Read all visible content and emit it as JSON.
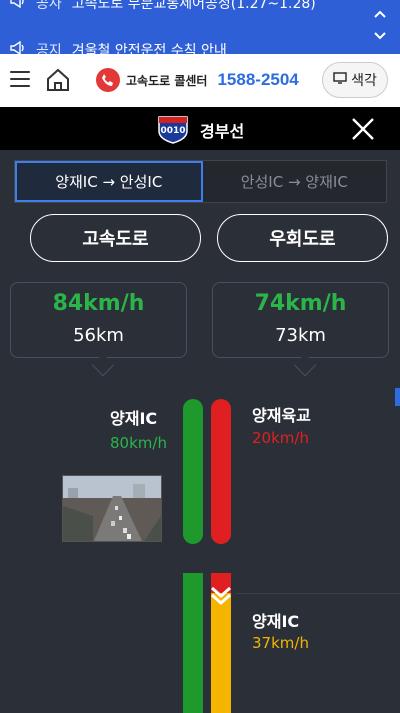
{
  "notice": {
    "items": [
      {
        "tag": "공사",
        "text": "고속도로 부분교통제어공정(1.27~1.28)"
      },
      {
        "tag": "공지",
        "text": "겨울철 안전운전 수칙 안내"
      }
    ]
  },
  "header": {
    "callcenter_label": "고속도로 콜센터",
    "callcenter_number": "1588-2504",
    "color_button_label": "색각"
  },
  "titlebar": {
    "route_number": "0010",
    "route_name": "경부선"
  },
  "direction_tabs": [
    {
      "label": "양재IC → 안성IC",
      "active": true
    },
    {
      "label": "안성IC → 양재IC",
      "active": false
    }
  ],
  "road_buttons": {
    "highway": "고속도로",
    "detour": "우회도로"
  },
  "speed_cards": [
    {
      "speed": "84km/h",
      "distance": "56km"
    },
    {
      "speed": "74km/h",
      "distance": "73km"
    }
  ],
  "segments": {
    "left_ic": {
      "name": "양재IC",
      "speed": "80km/h"
    },
    "right_top": {
      "name": "양재육교",
      "speed": "20km/h"
    },
    "right_bottom": {
      "name": "양재IC",
      "speed": "37km/h"
    }
  },
  "colors": {
    "green": "#1e9a2d",
    "red": "#e02020",
    "yellow": "#f5b400",
    "accent": "#2e6de0"
  }
}
